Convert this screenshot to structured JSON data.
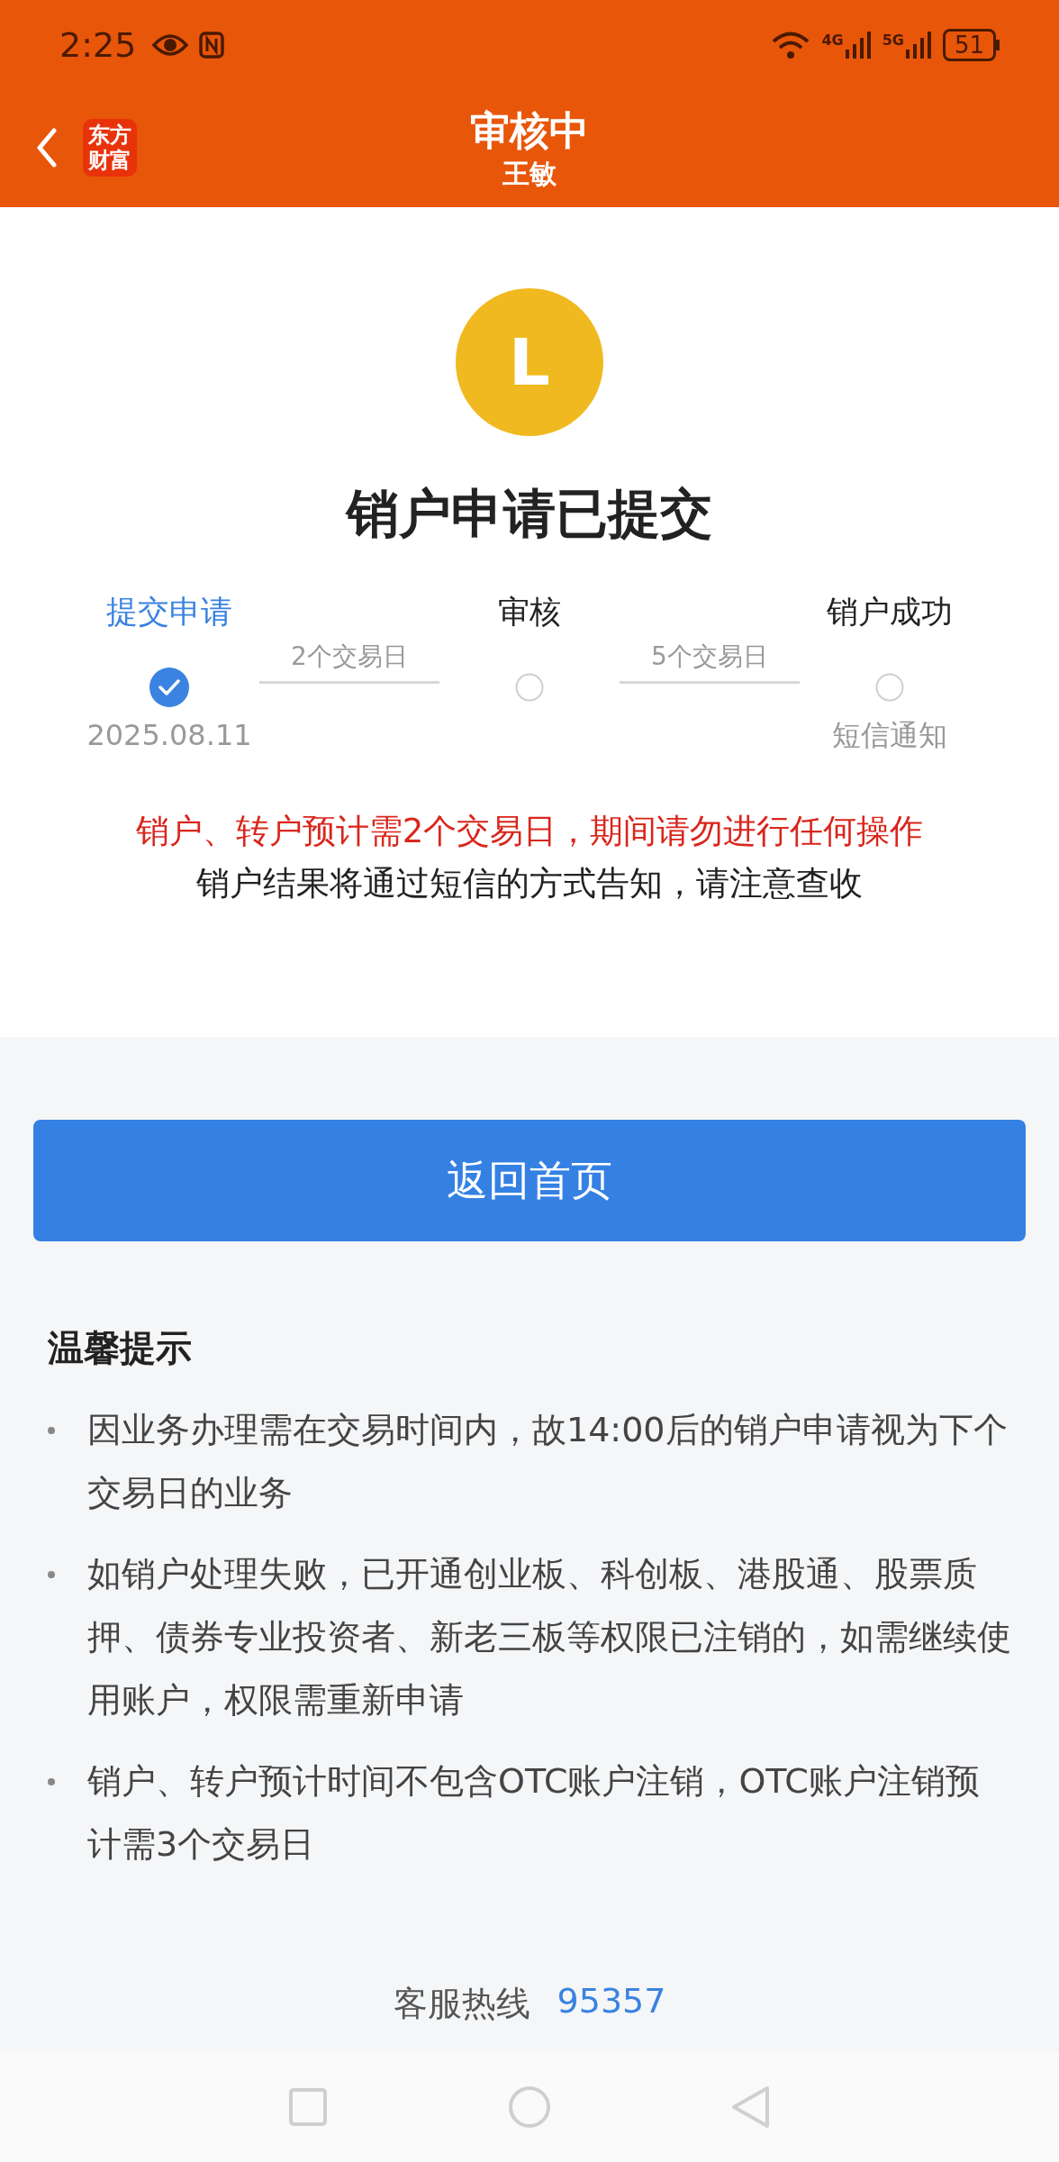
{
  "status_bar": {
    "time": "2:25",
    "network_1": "4G",
    "network_2": "5G",
    "battery": "51"
  },
  "header": {
    "title": "审核中",
    "subtitle": "王敏",
    "logo_line_1": "东方",
    "logo_line_2": "财富"
  },
  "status_icon": {
    "letter": "L"
  },
  "heading": "销户申请已提交",
  "steps": [
    {
      "label": "提交申请",
      "done": true,
      "note": "2025.08.11"
    },
    {
      "label": "审核",
      "done": false
    },
    {
      "label": "销户成功",
      "done": false,
      "note": "短信通知"
    }
  ],
  "connectors": [
    "2个交易日",
    "5个交易日"
  ],
  "notices": [
    {
      "kind": "warning",
      "text": "销户、转户预计需2个交易日，期间请勿进行任何操作"
    },
    {
      "kind": "info",
      "text": "销户结果将通过短信的方式告知，请注意查收"
    }
  ],
  "button": "返回首页",
  "tips": {
    "title": "温馨提示",
    "items": [
      "因业务办理需在交易时间内，故14:00后的销户申请视为下个交易日的业务",
      "如销户处理失败，已开通创业板、科创板、港股通、股票质押、债券专业投资者、新老三板等权限已注销的，如需继续使用账户，权限需重新申请",
      "销户、转户预计时间不包含OTC账户注销，OTC账户注销预计需3个交易日"
    ]
  },
  "hotline": {
    "label": "客服热线",
    "number": "95357"
  }
}
